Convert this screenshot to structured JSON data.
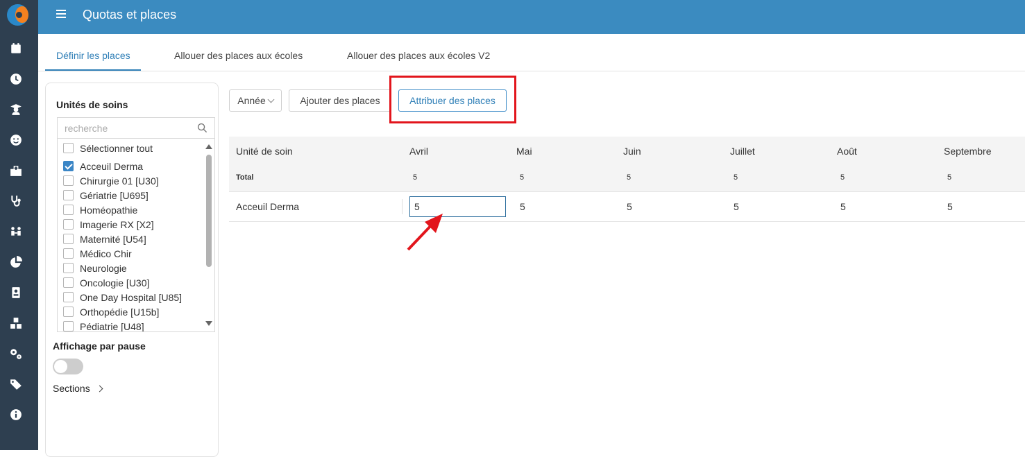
{
  "header": {
    "title": "Quotas et places"
  },
  "sidebar": {
    "icons": [
      "app-logo-icon",
      "calendar-icon",
      "clock-icon",
      "student-icon",
      "smiley-icon",
      "hospital-icon",
      "stethoscope-icon",
      "people-icon",
      "pie-chart-icon",
      "id-card-icon",
      "boxes-icon",
      "cogs-icon",
      "tags-icon",
      "info-icon"
    ]
  },
  "tabs": [
    {
      "label": "Définir les places",
      "active": true
    },
    {
      "label": "Allouer des places aux écoles",
      "active": false
    },
    {
      "label": "Allouer des places aux écoles V2",
      "active": false
    }
  ],
  "filter_panel": {
    "title": "Unités de soins",
    "search_placeholder": "recherche",
    "select_all_label": "Sélectionner tout",
    "units": [
      {
        "label": "Acceuil Derma",
        "checked": true
      },
      {
        "label": "Chirurgie 01 [U30]",
        "checked": false
      },
      {
        "label": "Gériatrie [U695]",
        "checked": false
      },
      {
        "label": "Homéopathie",
        "checked": false
      },
      {
        "label": "Imagerie RX [X2]",
        "checked": false
      },
      {
        "label": "Maternité [U54]",
        "checked": false
      },
      {
        "label": "Médico Chir",
        "checked": false
      },
      {
        "label": "Neurologie",
        "checked": false
      },
      {
        "label": "Oncologie [U30]",
        "checked": false
      },
      {
        "label": "One Day Hospital [U85]",
        "checked": false
      },
      {
        "label": "Orthopédie [U15b]",
        "checked": false
      },
      {
        "label": "Pédiatrie [U48]",
        "checked": false
      }
    ],
    "pause_label": "Affichage par pause",
    "pause_toggle_on": false,
    "sections_label": "Sections"
  },
  "toolbar": {
    "year_label": "Année",
    "add_label": "Ajouter des places",
    "assign_label": "Attribuer des places",
    "accent_color": "#2f7fb7",
    "highlight_color": "#e2151c"
  },
  "grid": {
    "unit_col_label": "Unité de soin",
    "months": [
      "Avril",
      "Mai",
      "Juin",
      "Juillet",
      "Août",
      "Septembre"
    ],
    "total_label": "Total",
    "totals": [
      "5",
      "5",
      "5",
      "5",
      "5",
      "5"
    ],
    "rows": [
      {
        "unit": "Acceuil Derma",
        "values": [
          "5",
          "5",
          "5",
          "5",
          "5",
          "5"
        ]
      }
    ]
  }
}
